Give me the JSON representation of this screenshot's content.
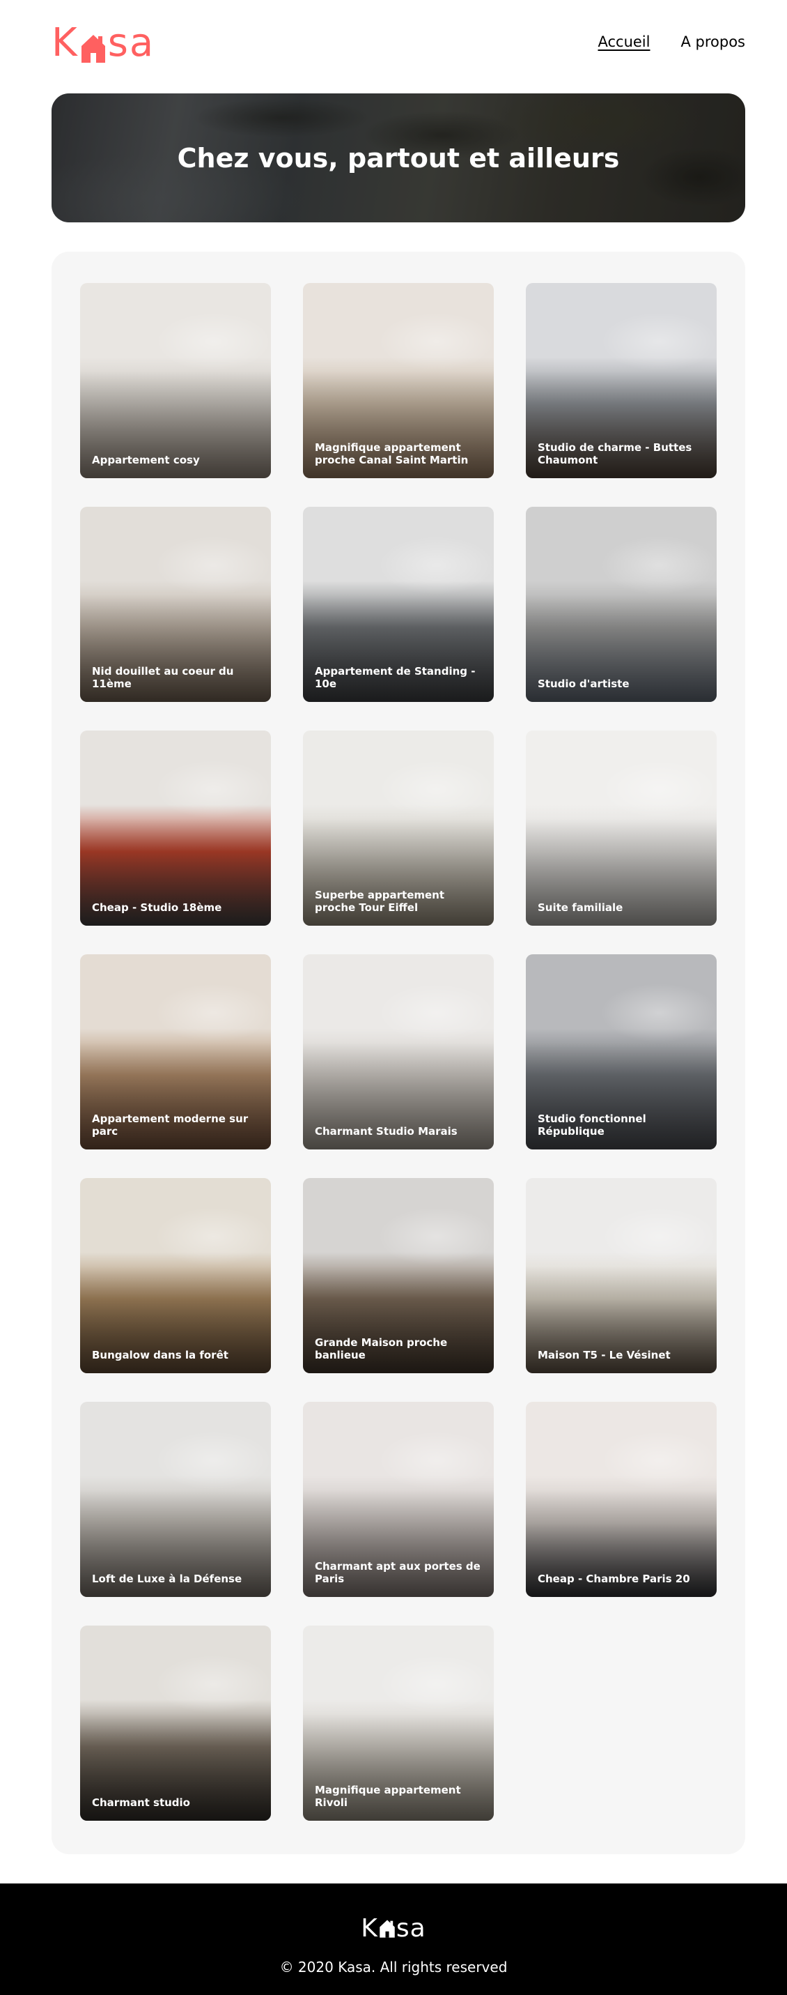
{
  "header": {
    "logo_left": "K",
    "logo_right": "sa",
    "nav": [
      {
        "label": "Accueil",
        "active": true
      },
      {
        "label": "A propos",
        "active": false
      }
    ]
  },
  "banner": {
    "title": "Chez vous, partout et ailleurs"
  },
  "gallery": {
    "cards": [
      {
        "title": "Appartement cosy",
        "tone": [
          "#e9e6e2",
          "#c9c4bd",
          "#8a7f74"
        ]
      },
      {
        "title": "Magnifique appartement proche Canal Saint Martin",
        "tone": [
          "#e8e2dc",
          "#c7b7a3",
          "#8d7259"
        ]
      },
      {
        "title": "Studio de charme - Buttes Chaumont",
        "tone": [
          "#d9dadd",
          "#8b8f94",
          "#4a3d33"
        ]
      },
      {
        "title": "Nid douillet au coeur du 11ème",
        "tone": [
          "#e2ded9",
          "#b9ada0",
          "#6b5c4d"
        ]
      },
      {
        "title": "Appartement de Standing - 10e",
        "tone": [
          "#dedede",
          "#6f7275",
          "#3a3c3f"
        ]
      },
      {
        "title": "Studio d'artiste",
        "tone": [
          "#cfcfcf",
          "#9b9b9a",
          "#5d6570"
        ]
      },
      {
        "title": "Cheap - Studio 18ème",
        "tone": [
          "#e6e3df",
          "#b9422c",
          "#3e3e3e"
        ]
      },
      {
        "title": "Superbe appartement proche Tour Eiffel",
        "tone": [
          "#ecebe8",
          "#cfcbc2",
          "#8e8574"
        ]
      },
      {
        "title": "Suite familiale",
        "tone": [
          "#f0efed",
          "#dcdad7",
          "#a6a4a0"
        ]
      },
      {
        "title": "Appartement moderne sur parc",
        "tone": [
          "#e4dcd3",
          "#b08b69",
          "#6b4a36"
        ]
      },
      {
        "title": "Charmant Studio Marais",
        "tone": [
          "#ebe9e7",
          "#cfcac4",
          "#9a938a"
        ]
      },
      {
        "title": "Studio fonctionnel République",
        "tone": [
          "#b8b9bc",
          "#6f7378",
          "#46484d"
        ]
      },
      {
        "title": "Bungalow dans la forêt",
        "tone": [
          "#e3ddd3",
          "#a8875f",
          "#5b4631"
        ]
      },
      {
        "title": "Grande Maison proche banlieue",
        "tone": [
          "#d6d4d2",
          "#7d6b59",
          "#3e3329"
        ]
      },
      {
        "title": "Maison T5 - Le Vésinet",
        "tone": [
          "#ecebea",
          "#d8d1c3",
          "#5a4d40"
        ]
      },
      {
        "title": "Loft de Luxe à la Défense",
        "tone": [
          "#e4e3e1",
          "#bdb8b1",
          "#6e6760"
        ]
      },
      {
        "title": "Charmant apt aux portes de Paris",
        "tone": [
          "#e9e5e3",
          "#c5beba",
          "#7a706c"
        ]
      },
      {
        "title": "Cheap - Chambre Paris 20",
        "tone": [
          "#ece7e4",
          "#c9c2bd",
          "#2d2d30"
        ]
      },
      {
        "title": "Charmant studio",
        "tone": [
          "#e2dfda",
          "#7a6f62",
          "#2f2b26"
        ]
      },
      {
        "title": "Magnifique appartement Rivoli",
        "tone": [
          "#ecebe9",
          "#cfcac2",
          "#8a8376"
        ]
      }
    ]
  },
  "footer": {
    "logo_left": "K",
    "logo_right": "sa",
    "copyright": "© 2020 Kasa. All rights reserved"
  },
  "colors": {
    "brand": "#FF6060",
    "gallery_bg": "#F6F6F6",
    "footer_bg": "#000000"
  }
}
